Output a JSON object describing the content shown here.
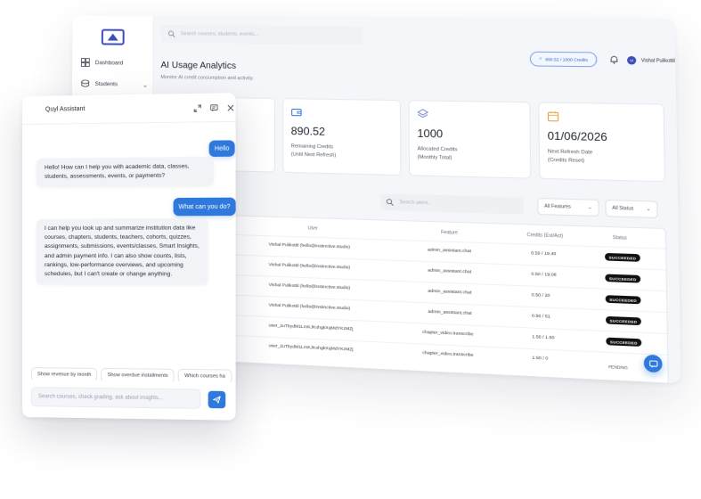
{
  "dashboard": {
    "search_placeholder": "Search courses, students, events...",
    "nav": [
      {
        "label": "Dashboard",
        "icon": "grid-icon"
      },
      {
        "label": "Students",
        "icon": "students-icon"
      }
    ],
    "credit_pill": "890.52 / 1000 Credits",
    "user_initials": "VI",
    "user_name": "Vishal Pulikottil",
    "title": "AI Usage Analytics",
    "subtitle": "Monitor AI credit consumption and activity.",
    "cards": [
      {
        "icon": "activity-icon",
        "value": "",
        "label1": "",
        "label2": ""
      },
      {
        "icon": "wallet-icon",
        "value": "890.52",
        "label1": "Remaining Credits",
        "label2": "(Until Next Refresh)"
      },
      {
        "icon": "layers-icon",
        "value": "1000",
        "label1": "Allocated Credits",
        "label2": "(Monthly Total)"
      },
      {
        "icon": "calendar-icon",
        "value": "01/06/2026",
        "label1": "Next Refresh Date",
        "label2": "(Credits Reset)"
      }
    ],
    "filter_search_placeholder": "Search users...",
    "features_filter": "All Features",
    "status_filter": "All Status",
    "table": {
      "headers": [
        "User",
        "Feature",
        "Credits (Est/Act)",
        "Status"
      ],
      "rows": [
        {
          "user": "Vishal Pulikottil (hello@instinctive.studio)",
          "feature": "admin_assistant.chat",
          "credits": "0.50 / 19.40",
          "status": "SUCCEEDED"
        },
        {
          "user": "Vishal Pulikottil (hello@instinctive.studio)",
          "feature": "admin_assistant.chat",
          "credits": "0.50 / 19.08",
          "status": "SUCCEEDED"
        },
        {
          "user": "Vishal Pulikottil (hello@instinctive.studio)",
          "feature": "admin_assistant.chat",
          "credits": "0.50 / 20",
          "status": "SUCCEEDED"
        },
        {
          "user": "Vishal Pulikottil (hello@instinctive.studio)",
          "feature": "admin_assistant.chat",
          "credits": "0.50 / 51",
          "status": "SUCCEEDED"
        },
        {
          "user": "user_2uTbydM1LmKJKohgkXqMdYKzMZj",
          "feature": "chapter_video.transcribe",
          "credits": "1.50 / 1.50",
          "status": "SUCCEEDED"
        },
        {
          "user": "user_2uTbydM1LmKJKohgkXqMdYKzMZj",
          "feature": "chapter_video.transcribe",
          "credits": "1.50 / 0",
          "status": "PENDING"
        }
      ]
    }
  },
  "chat": {
    "title": "Quyl Assistant",
    "messages": [
      {
        "role": "user",
        "text": "Hello"
      },
      {
        "role": "bot",
        "text": "Hello! How can I help you with academic data, classes, students, assessments, events, or payments?"
      },
      {
        "role": "user",
        "text": "What can you do?"
      },
      {
        "role": "bot",
        "text": "I can help you look up and summarize institution data like courses, chapters, students, teachers, cohorts, quizzes, assignments, submissions, events/classes, Smart Insights, and admin payment info. I can also show counts, lists, rankings, low-performance overviews, and upcoming schedules, but I can't create or change anything."
      }
    ],
    "suggestions": [
      "Show revenue by month",
      "Show overdue installments",
      "Which courses ha"
    ],
    "input_placeholder": "Search courses, check grading, ask about insights..."
  },
  "colors": {
    "accent": "#2f79dc",
    "badge": "#111111"
  }
}
